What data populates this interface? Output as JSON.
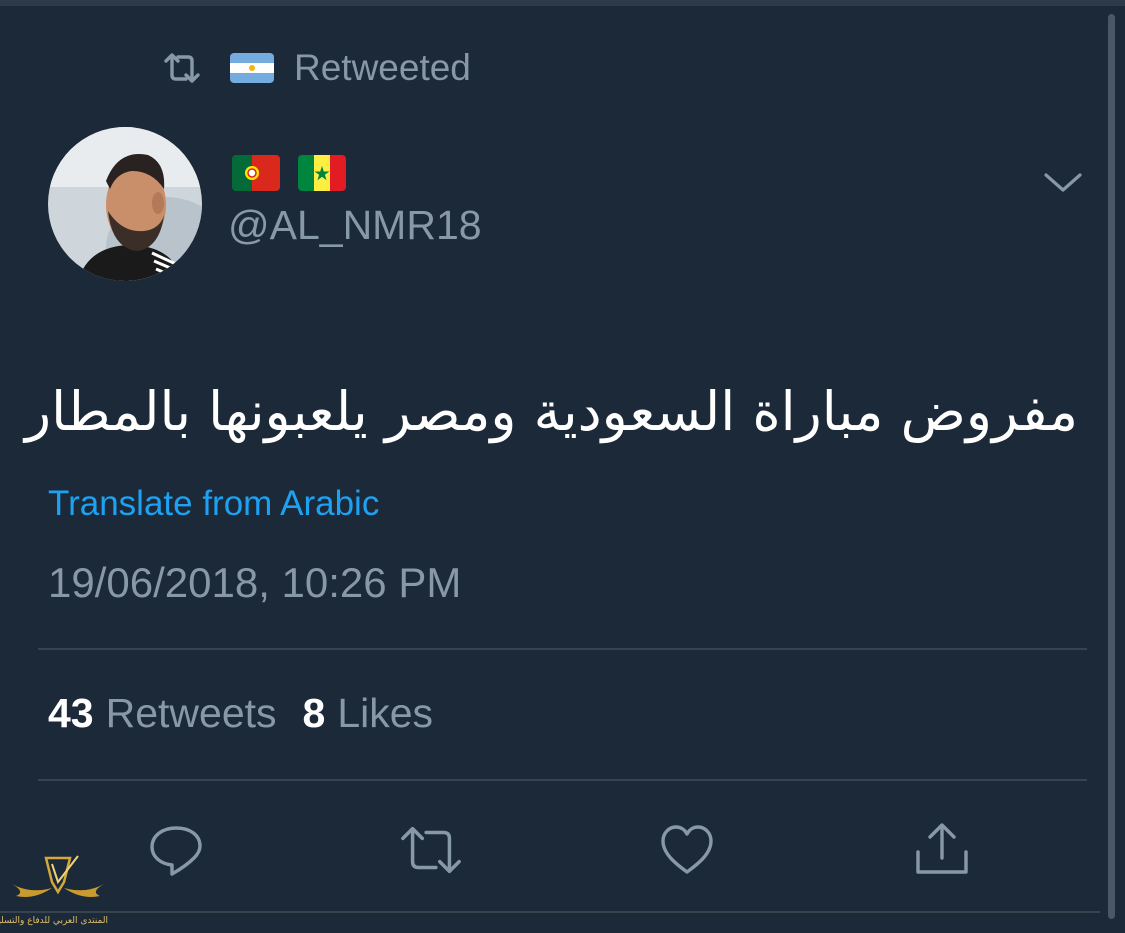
{
  "retweet_context": {
    "label": "Retweeted",
    "icon": "retweet-icon",
    "flag": "argentina-flag"
  },
  "author": {
    "flags": [
      "portugal-flag",
      "senegal-flag"
    ],
    "handle": "@AL_NMR18"
  },
  "tweet": {
    "text": "مفروض مباراة السعودية ومصر يلعبونها بالمطار",
    "translate_label": "Translate from Arabic",
    "timestamp": "19/06/2018, 10:26 PM"
  },
  "stats": {
    "retweets_count": "43",
    "retweets_label": "Retweets",
    "likes_count": "8",
    "likes_label": "Likes"
  },
  "actions": [
    "reply-icon",
    "retweet-icon",
    "like-icon",
    "share-icon"
  ],
  "watermark": {
    "text": "المنتدى العربي للدفاع والتسليح"
  },
  "colors": {
    "background": "#1c2938",
    "secondary_text": "#8899a6",
    "link": "#1da1f2",
    "divider": "#38444d"
  }
}
